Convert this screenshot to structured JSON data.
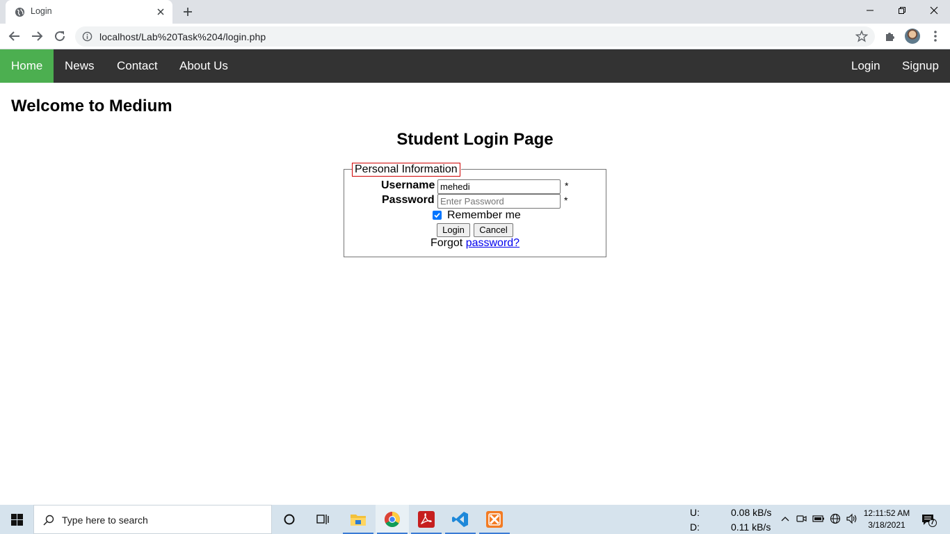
{
  "browser": {
    "tab_title": "Login",
    "url": "localhost/Lab%20Task%204/login.php"
  },
  "navbar": {
    "left": [
      "Home",
      "News",
      "Contact",
      "About Us"
    ],
    "right": [
      "Login",
      "Signup"
    ],
    "active_item": "Home",
    "active_color": "#4caf50",
    "background": "#333333"
  },
  "page": {
    "welcome": "Welcome to Medium",
    "heading": "Student Login Page",
    "form": {
      "legend": "Personal Information",
      "username_label": "Username",
      "username_value": "mehedi",
      "password_label": "Password",
      "password_placeholder": "Enter Password",
      "required_mark": "*",
      "remember_label": "Remember me",
      "remember_checked": true,
      "login_button": "Login",
      "cancel_button": "Cancel",
      "forgot_text": "Forgot",
      "forgot_link": "password?"
    }
  },
  "taskbar": {
    "search_placeholder": "Type here to search",
    "apps": [
      "cortana-icon",
      "task-view-icon",
      "file-explorer-icon",
      "chrome-icon",
      "acrobat-icon",
      "vscode-icon",
      "xampp-icon"
    ],
    "net_upload_label": "U:",
    "net_upload_value": "0.08 kB/s",
    "net_download_label": "D:",
    "net_download_value": "0.11 kB/s",
    "time": "12:11:52 AM",
    "date": "3/18/2021",
    "notification_count": "7"
  }
}
